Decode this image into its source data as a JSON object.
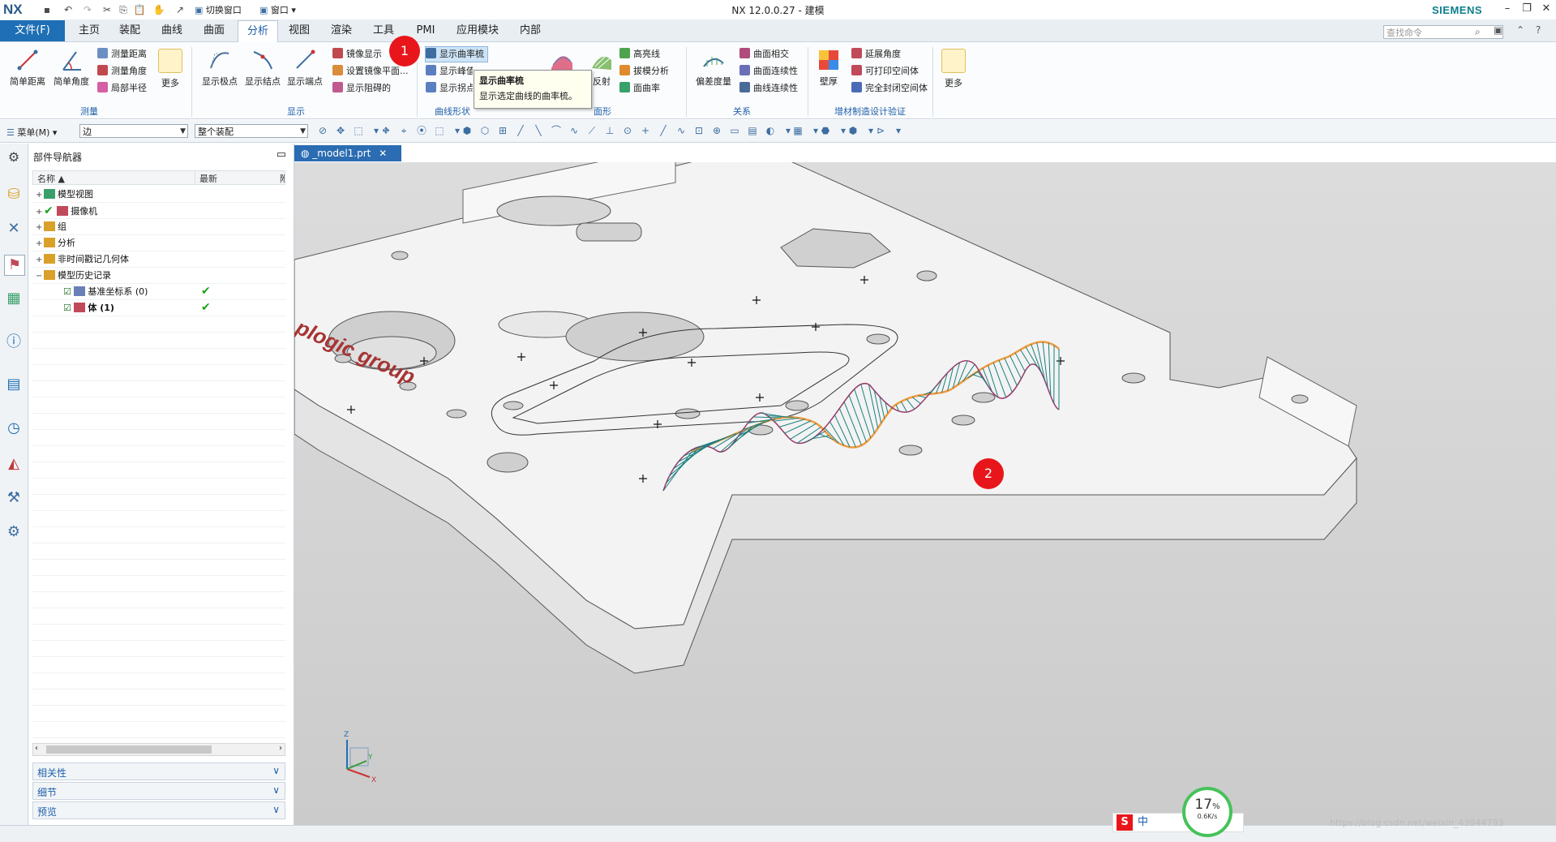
{
  "window": {
    "logo": "NX",
    "title": "NX 12.0.0.27 - 建模",
    "brand": "SIEMENS",
    "switch_window_label": "切换窗口",
    "window_menu_label": "窗口"
  },
  "menu": {
    "file_tab": "文件(F)",
    "tabs": [
      "主页",
      "装配",
      "曲线",
      "曲面",
      "分析",
      "视图",
      "渲染",
      "工具",
      "PMI",
      "应用模块",
      "内部"
    ],
    "active_tab": "分析",
    "search_placeholder": "查找命令"
  },
  "ribbon": {
    "measure": {
      "group_label": "测量",
      "simple_distance": "简单距离",
      "simple_angle": "简单角度",
      "measure_distance": "测量距离",
      "measure_angle": "测量角度",
      "local_radius": "局部半径",
      "more": "更多"
    },
    "display": {
      "group_label": "显示",
      "show_poles": "显示极点",
      "show_knots": "显示结点",
      "show_endpoints": "显示端点",
      "mirror_display": "镜像显示",
      "set_mirror_plane": "设置镜像平面...",
      "show_obstruction": "显示阻碍的"
    },
    "curve_shape": {
      "group_label": "曲线形状",
      "show_curvature_comb": "显示曲率梳",
      "show_peak": "显示峰值点",
      "show_inflection": "显示拐点"
    },
    "face_shape": {
      "group_label": "面形状",
      "reflect": "反射",
      "highlight_lines": "高亮线",
      "draft_analysis": "拔模分析",
      "face_curvature": "面曲率"
    },
    "relation": {
      "group_label": "关系",
      "deviation_gauge": "偏差度量",
      "surface_intersection": "曲面相交",
      "surface_continuity": "曲面连续性",
      "curve_continuity": "曲线连续性"
    },
    "am": {
      "group_label": "增材制造设计验证",
      "wall_thickness": "壁厚",
      "overhang_angle": "延展角度",
      "printable_void": "可打印空间体",
      "fully_enclosed_void": "完全封闭空间体",
      "more": "更多"
    }
  },
  "tooltip": {
    "title": "显示曲率梳",
    "body": "显示选定曲线的曲率梳。"
  },
  "callouts": [
    "1",
    "2"
  ],
  "toolbar2": {
    "menu_label": "菜单(M)",
    "filter_value": "边",
    "scope_value": "整个装配"
  },
  "navigator": {
    "title": "部件导航器",
    "col_name": "名称",
    "col_latest": "最新",
    "col_extra": "附",
    "nodes": [
      {
        "label": "模型视图",
        "expander": "+"
      },
      {
        "label": "摄像机",
        "expander": "+"
      },
      {
        "label": "组",
        "expander": "+"
      },
      {
        "label": "分析",
        "expander": "+"
      },
      {
        "label": "非时间戳记几何体",
        "expander": "+"
      },
      {
        "label": "模型历史记录",
        "expander": "−"
      }
    ],
    "history": [
      {
        "label": "基准坐标系 (0)"
      },
      {
        "label": "体 (1)"
      }
    ],
    "panels": [
      "相关性",
      "细节",
      "预览"
    ]
  },
  "graphics": {
    "tab_label": "_model1.prt",
    "part_logo_text": "plogic group",
    "axes": {
      "z": "Z",
      "y": "Y",
      "x": "X"
    }
  },
  "status": {
    "net_percent": "17",
    "net_unit": "%",
    "net_rate": "0.6K/s",
    "ime_label": "中",
    "watermark": "https://blog.csdn.net/weixin_43944783"
  },
  "colors": {
    "accent": "#1e6fb5",
    "curve_comb": "#1a7f7f",
    "comb_envelope": "#9a3a6a",
    "selected_edge": "#f29a3a",
    "callout": "#e8161b"
  }
}
